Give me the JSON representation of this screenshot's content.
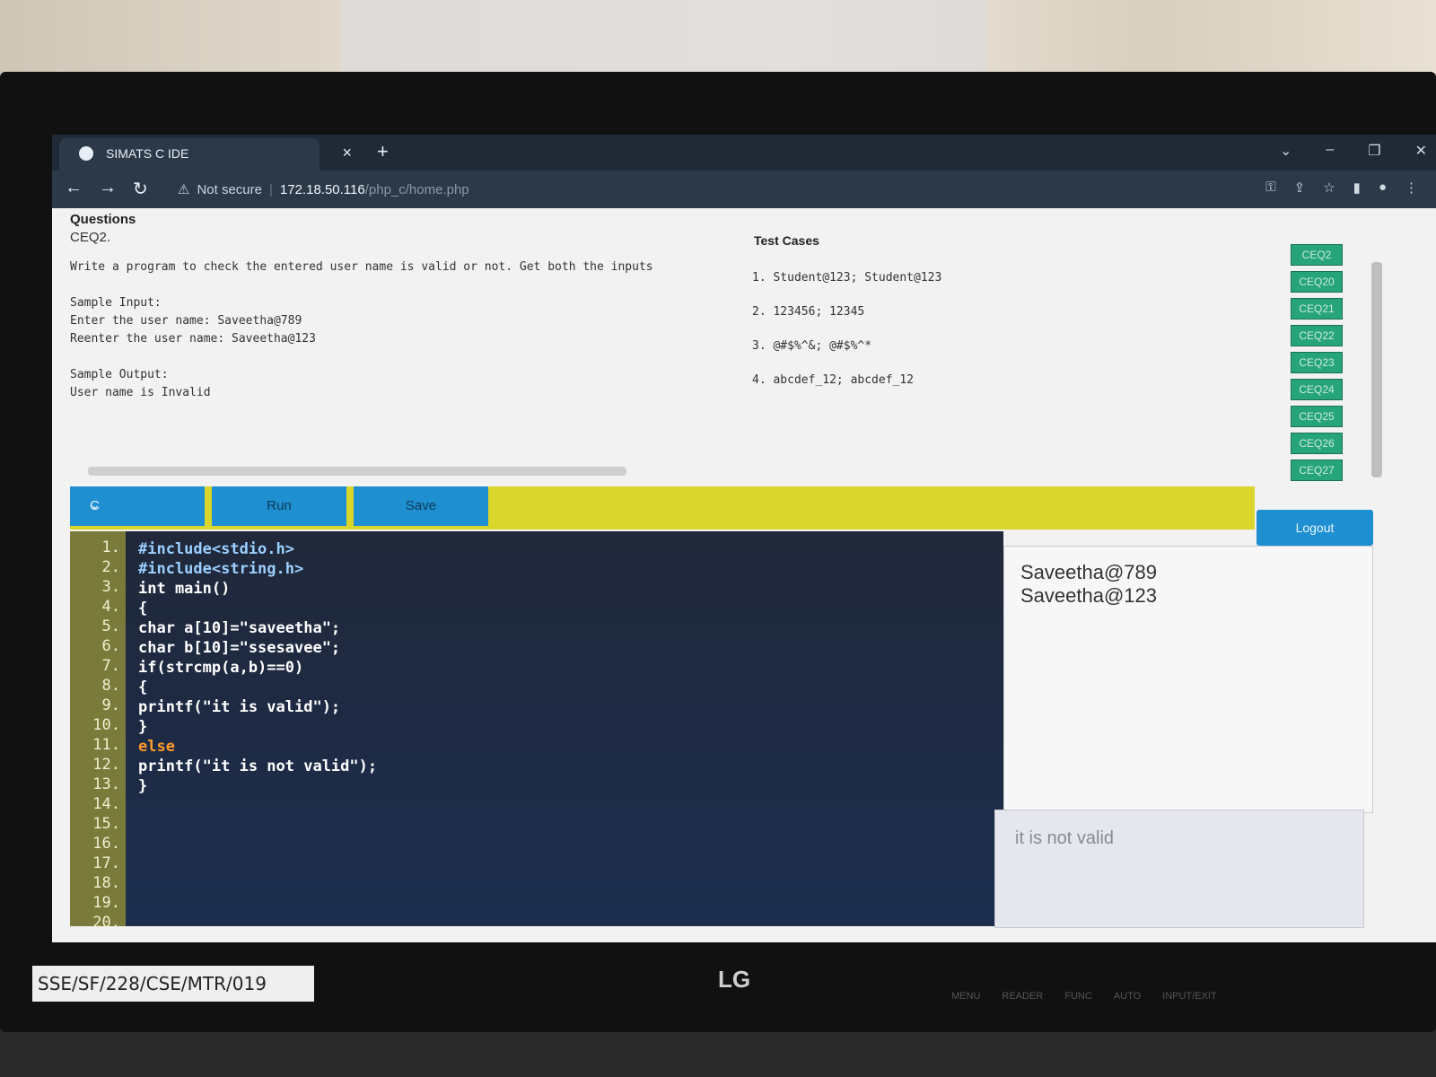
{
  "browser": {
    "tab_title": "SIMATS C IDE",
    "tab_close": "×",
    "new_tab": "+",
    "security": "Not secure",
    "url_host": "172.18.50.116",
    "url_path": "/php_c/home.php"
  },
  "page": {
    "questions_label": "Questions",
    "question_id": "CEQ2.",
    "question_body": "Write a program to check the entered user name is valid or not. Get both the inputs\n\nSample Input:\nEnter the user name: Saveetha@789\nReenter the user name: Saveetha@123\n\nSample Output:\nUser name is Invalid",
    "test_cases_label": "Test Cases",
    "test_cases": [
      "1. Student@123; Student@123",
      "2. 123456; 12345",
      "3. @#$%^&; @#$%^*",
      "4. abcdef_12; abcdef_12"
    ],
    "ceq_list": [
      "CEQ2",
      "CEQ20",
      "CEQ21",
      "CEQ22",
      "CEQ23",
      "CEQ24",
      "CEQ25",
      "CEQ26",
      "CEQ27"
    ]
  },
  "toolbar": {
    "language": "C",
    "run_label": "Run",
    "save_label": "Save",
    "logout_label": "Logout"
  },
  "editor": {
    "line_numbers": [
      "1.",
      "2.",
      "3.",
      "4.",
      "5.",
      "6.",
      "7.",
      "8.",
      "9.",
      "10.",
      "11.",
      "12.",
      "13.",
      "14.",
      "15.",
      "16.",
      "17.",
      "18.",
      "19.",
      "20."
    ],
    "lines": [
      "#include<stdio.h>",
      "#include<string.h>",
      "int main()",
      "{",
      "char a[10]=\"saveetha\";",
      "char b[10]=\"ssesavee\";",
      "if(strcmp(a,b)==0)",
      "{",
      "printf(\"it is valid\");",
      "}",
      "else",
      "printf(\"it is not valid\");",
      "}"
    ]
  },
  "io": {
    "input": "Saveetha@789\nSaveetha@123",
    "output": "it is not valid"
  },
  "monitor": {
    "sticker": "SSE/SF/228/CSE/MTR/019",
    "brand": "LG",
    "buttons": [
      "MENU",
      "READER",
      "FUNC",
      "AUTO",
      "INPUT/EXIT"
    ]
  }
}
